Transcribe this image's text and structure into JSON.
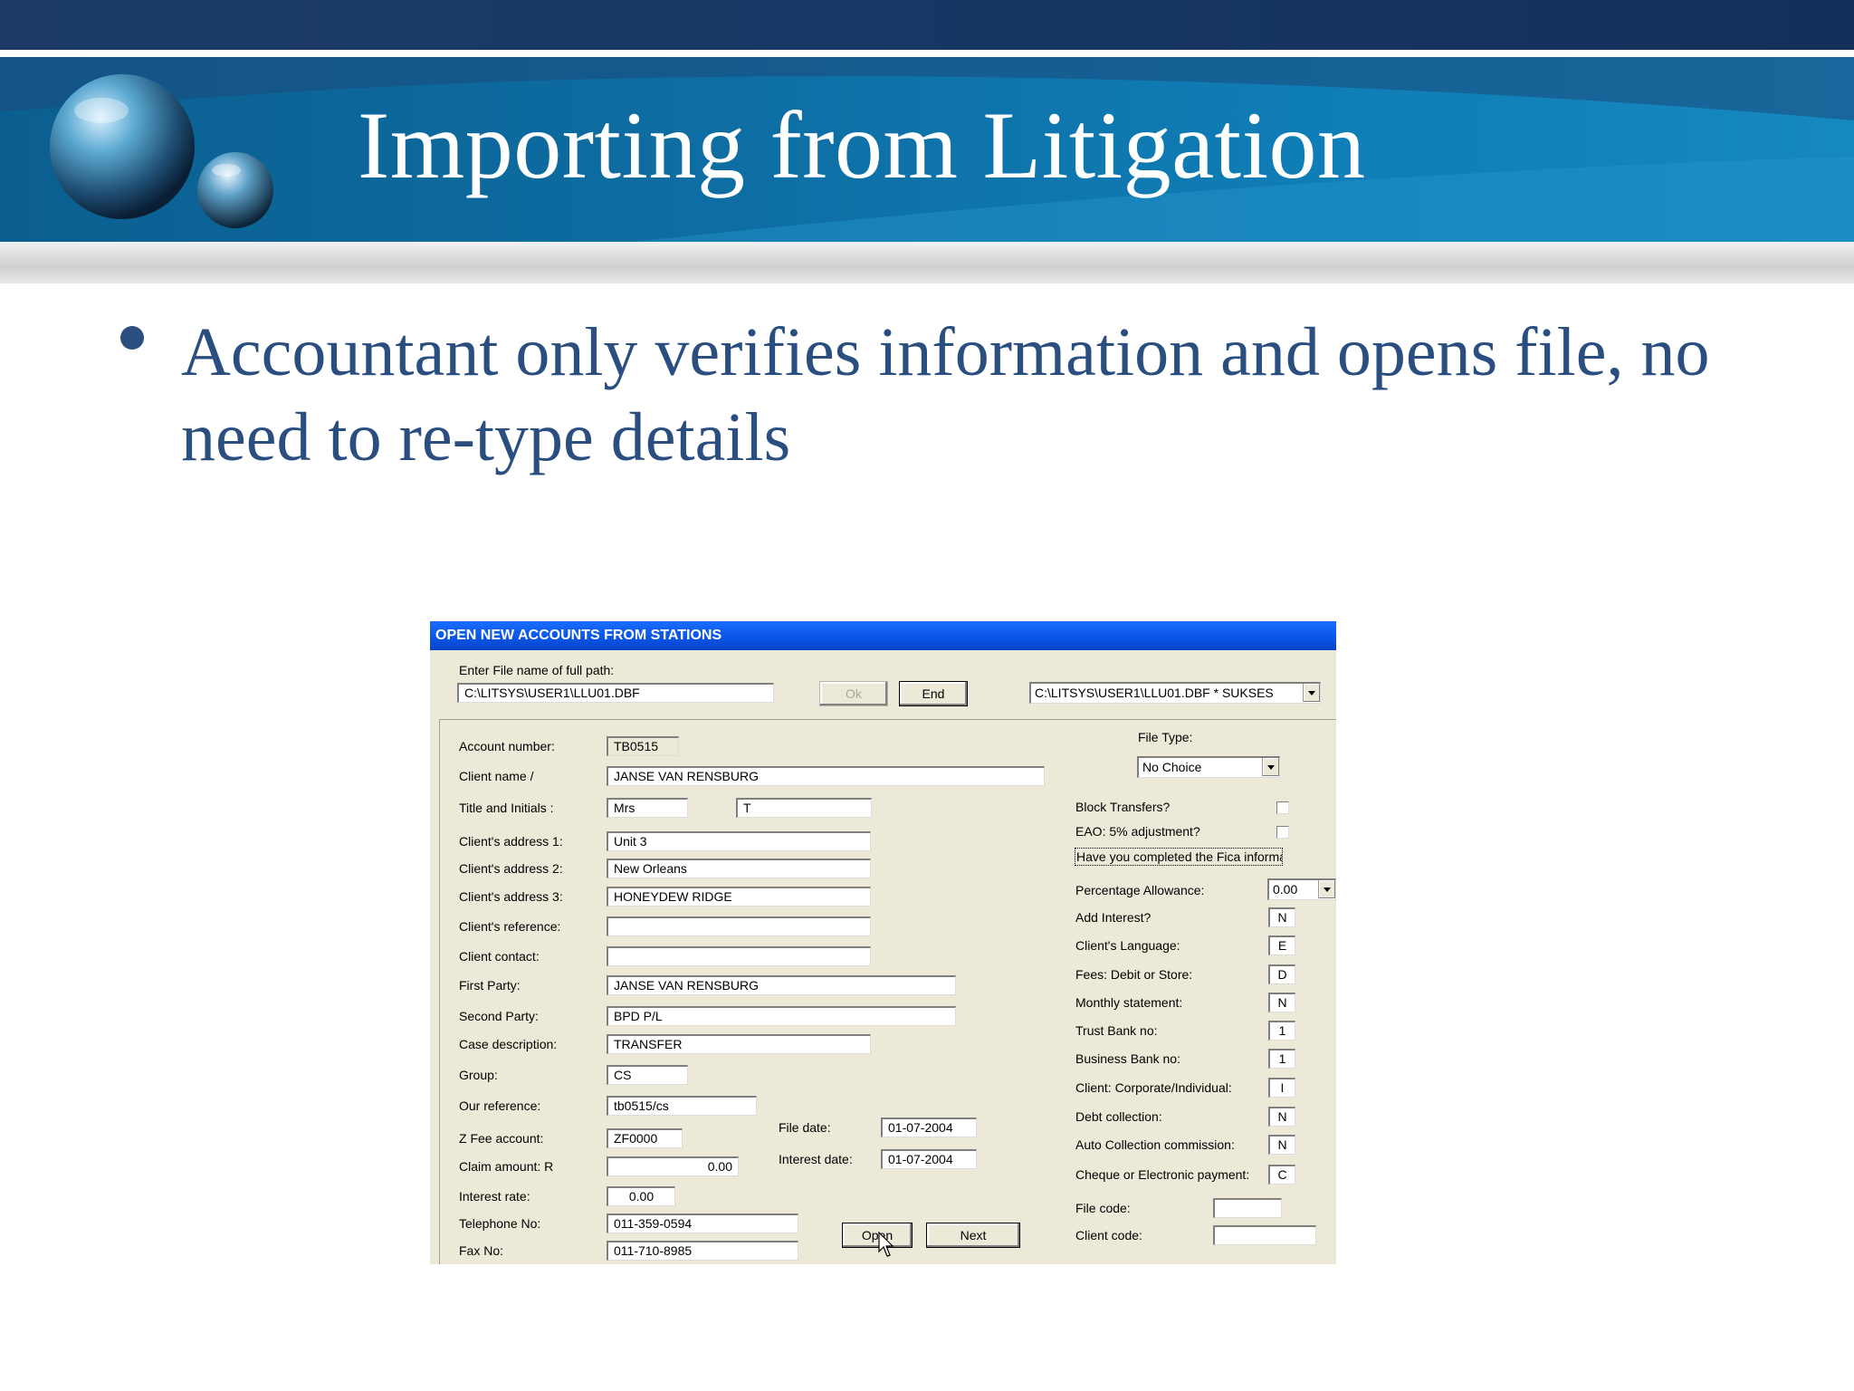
{
  "slide": {
    "title": "Importing from Litigation",
    "bullet": "Accountant only verifies information and opens file, no need to re-type details"
  },
  "dialog": {
    "title": "OPEN NEW ACCOUNTS FROM STATIONS",
    "file_label": "Enter File name of full path:",
    "file_value": "C:\\LITSYS\\USER1\\LLU01.DBF",
    "ok_label": "Ok",
    "end_label": "End",
    "station_combo": "C:\\LITSYS\\USER1\\LLU01.DBF * SUKSES",
    "file_type_label": "File Type:",
    "file_type_value": "No Choice",
    "left_fields": {
      "account_number": {
        "label": "Account number:",
        "value": "TB0515"
      },
      "client_name": {
        "label": "Client name /",
        "value": "JANSE VAN RENSBURG"
      },
      "title_initials": {
        "label": "Title and Initials  :",
        "title": "Mrs",
        "initials": "T"
      },
      "address1": {
        "label": "Client's address 1:",
        "value": "Unit 3"
      },
      "address2": {
        "label": "Client's address 2:",
        "value": "New Orleans"
      },
      "address3": {
        "label": "Client's address 3:",
        "value": "HONEYDEW RIDGE"
      },
      "client_reference": {
        "label": "Client's reference:",
        "value": ""
      },
      "client_contact": {
        "label": "Client contact:",
        "value": ""
      },
      "first_party": {
        "label": "First Party:",
        "value": "JANSE VAN RENSBURG"
      },
      "second_party": {
        "label": "Second Party:",
        "value": "BPD P/L"
      },
      "case_description": {
        "label": "Case description:",
        "value": "TRANSFER"
      },
      "group": {
        "label": "Group:",
        "value": "CS"
      },
      "our_reference": {
        "label": "Our reference:",
        "value": "tb0515/cs"
      },
      "z_fee_account": {
        "label": "Z Fee account:",
        "value": "ZF0000"
      },
      "claim_amount": {
        "label": "Claim amount: R",
        "value": "0.00"
      },
      "interest_rate": {
        "label": "Interest rate:",
        "value": "0.00"
      },
      "telephone": {
        "label": "Telephone No:",
        "value": "011-359-0594"
      },
      "fax": {
        "label": "Fax No:",
        "value": "011-710-8985"
      }
    },
    "dates": {
      "file_date": {
        "label": "File date:",
        "value": "01-07-2004"
      },
      "interest_date": {
        "label": "Interest date:",
        "value": "01-07-2004"
      }
    },
    "open_label": "Open",
    "next_label": "Next",
    "right_fields": {
      "block_transfers": "Block Transfers?",
      "eao_adjustment": "EAO: 5% adjustment?",
      "fica": "Have you completed the Fica informati",
      "percentage_allowance": {
        "label": "Percentage Allowance:",
        "value": "0.00"
      },
      "add_interest": {
        "label": "Add Interest?",
        "value": "N"
      },
      "client_language": {
        "label": "Client's Language:",
        "value": "E"
      },
      "fees_debit_store": {
        "label": "Fees: Debit or Store:",
        "value": "D"
      },
      "monthly_statement": {
        "label": "Monthly statement:",
        "value": "N"
      },
      "trust_bank": {
        "label": "Trust Bank no:",
        "value": "1"
      },
      "business_bank": {
        "label": "Business Bank no:",
        "value": "1"
      },
      "client_corporate": {
        "label": "Client: Corporate/Individual:",
        "value": "I"
      },
      "debt_collection": {
        "label": "Debt collection:",
        "value": "N"
      },
      "auto_collection": {
        "label": "Auto Collection commission:",
        "value": "N"
      },
      "cheque_electronic": {
        "label": "Cheque or Electronic payment:",
        "value": "C"
      },
      "file_code": {
        "label": "File code:",
        "value": ""
      },
      "client_code": {
        "label": "Client code:",
        "value": ""
      }
    }
  },
  "colors": {
    "title_text": "#ffffff",
    "bullet_text": "#2a4e80",
    "banner": "#0e6ea3",
    "dialog_titlebar": "#0a56e8",
    "dialog_bg": "#ece9d8"
  }
}
